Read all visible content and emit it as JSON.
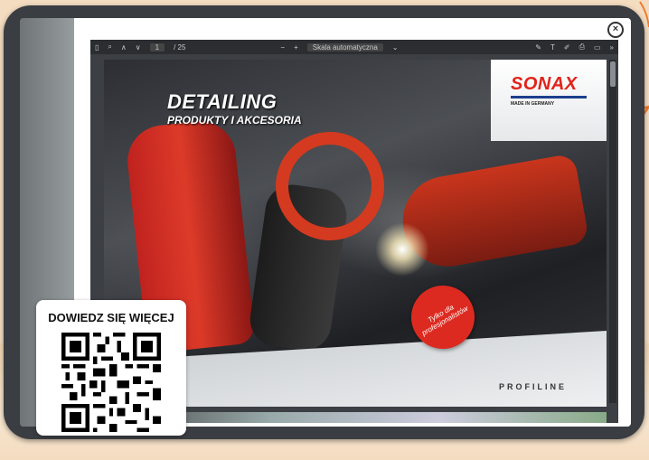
{
  "viewer": {
    "toolbar": {
      "page_current": "1",
      "page_total": "/ 25",
      "zoom_label": "Skala automatyczna"
    }
  },
  "page": {
    "title": "DETAILING",
    "subtitle": "PRODUKTY I AKCESORIA",
    "brand": "SONAX",
    "brand_sub": "MADE IN GERMANY",
    "badge": "Tylko dla profesjonalistów",
    "line": "PROFILINE"
  },
  "qr_card": {
    "title": "DOWIEDZ SIĘ WIĘCEJ"
  },
  "colors": {
    "accent_orange": "#f07a2a",
    "brand_red": "#e2231a"
  }
}
